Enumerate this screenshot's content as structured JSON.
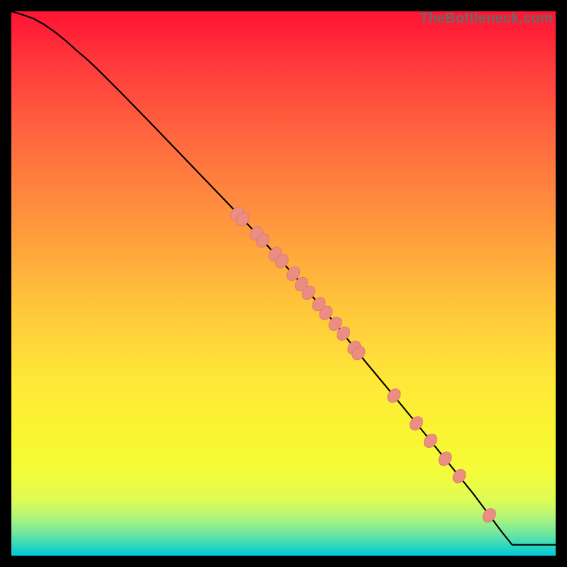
{
  "watermark": "TheBottleneck.com",
  "colors": {
    "curve": "#000000",
    "dot_fill": "#ec8d84",
    "dot_stroke": "#d87a72"
  },
  "chart_data": {
    "type": "line",
    "title": "",
    "xlabel": "",
    "ylabel": "",
    "xlim": [
      0,
      100
    ],
    "ylim": [
      0,
      100
    ],
    "grid": false,
    "legend": false,
    "series": [
      {
        "name": "curve",
        "x": [
          0,
          2,
          4,
          6,
          8,
          10,
          12,
          14,
          16,
          18,
          20,
          25,
          30,
          35,
          40,
          45,
          50,
          55,
          60,
          65,
          70,
          75,
          80,
          85,
          90,
          92,
          100
        ],
        "y": [
          100,
          99.4,
          98.7,
          97.6,
          96.2,
          94.6,
          92.8,
          91.1,
          89.2,
          87.2,
          85.2,
          80.1,
          74.9,
          69.7,
          64.5,
          59.2,
          53.7,
          48.0,
          42.0,
          35.7,
          29.7,
          23.6,
          17.4,
          11.2,
          4.5,
          2.0,
          2.0
        ]
      }
    ],
    "points": [
      {
        "x": 41.5,
        "y": 62.8
      },
      {
        "x": 42.5,
        "y": 61.8
      },
      {
        "x": 45.0,
        "y": 59.2
      },
      {
        "x": 46.2,
        "y": 57.9
      },
      {
        "x": 48.5,
        "y": 55.4
      },
      {
        "x": 49.7,
        "y": 54.1
      },
      {
        "x": 51.8,
        "y": 51.8
      },
      {
        "x": 53.3,
        "y": 49.9
      },
      {
        "x": 54.6,
        "y": 48.3
      },
      {
        "x": 56.5,
        "y": 46.2
      },
      {
        "x": 57.8,
        "y": 44.6
      },
      {
        "x": 59.5,
        "y": 42.6
      },
      {
        "x": 61.0,
        "y": 40.8
      },
      {
        "x": 63.0,
        "y": 38.2
      },
      {
        "x": 63.8,
        "y": 37.2
      },
      {
        "x": 70.3,
        "y": 29.4
      },
      {
        "x": 74.4,
        "y": 24.3
      },
      {
        "x": 77.0,
        "y": 21.1
      },
      {
        "x": 79.7,
        "y": 17.8
      },
      {
        "x": 82.3,
        "y": 14.6
      },
      {
        "x": 87.8,
        "y": 7.4
      }
    ]
  }
}
